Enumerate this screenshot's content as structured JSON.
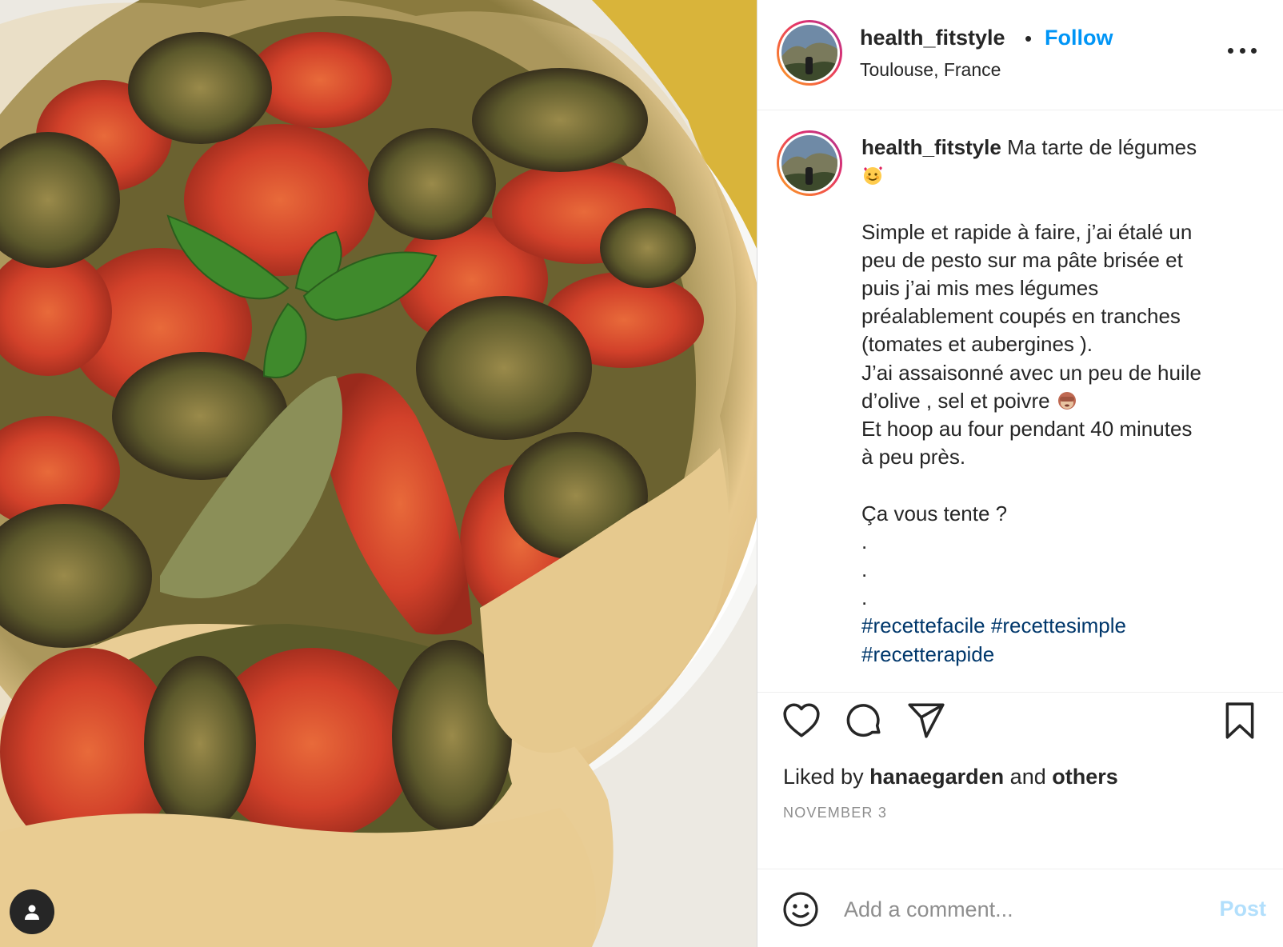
{
  "post": {
    "username": "health_fitstyle",
    "separator": "•",
    "follow_label": "Follow",
    "location": "Toulouse, France",
    "photo_subject": "vegetable tart with tomatoes, eggplant and basil"
  },
  "caption": {
    "username": "health_fitstyle",
    "lines": [
      "Ma tarte de légumes",
      "",
      "Simple et rapide à faire, j’ai étalé un",
      "peu de pesto sur ma pâte brisée et",
      "puis j’ai mis mes légumes",
      "préalablement coupés en tranches",
      "(tomates et aubergines ).",
      "J’ai assaisonné avec un peu de huile",
      "d’olive , sel et poivre",
      "Et hoop au four pendant 40 minutes",
      "à peu près.",
      "",
      "Ça vous tente ?",
      ".",
      ".",
      "."
    ],
    "hashtags": [
      "#recettefacile",
      "#recettesimple",
      "#recetterapide"
    ],
    "emojis": [
      "smiling-face-with-hearts",
      "see-no-evil-monkey"
    ]
  },
  "engagement": {
    "liked_prefix": "Liked by",
    "liked_user": "hanaegarden",
    "liked_joiner": "and",
    "liked_others": "others",
    "date": "NOVEMBER 3"
  },
  "comment": {
    "placeholder": "Add a comment...",
    "post_label": "Post"
  },
  "icons": {
    "like": "heart-icon",
    "comment": "comment-bubble-icon",
    "share": "paper-plane-icon",
    "save": "bookmark-icon",
    "more": "more-options-icon",
    "emoji": "emoji-smile-icon",
    "tag": "user-tag-icon"
  },
  "colors": {
    "follow": "#0095f6",
    "hashtag": "#00376b",
    "muted": "#8e8e8e",
    "post_disabled": "#b2dffc",
    "text": "#262626"
  }
}
